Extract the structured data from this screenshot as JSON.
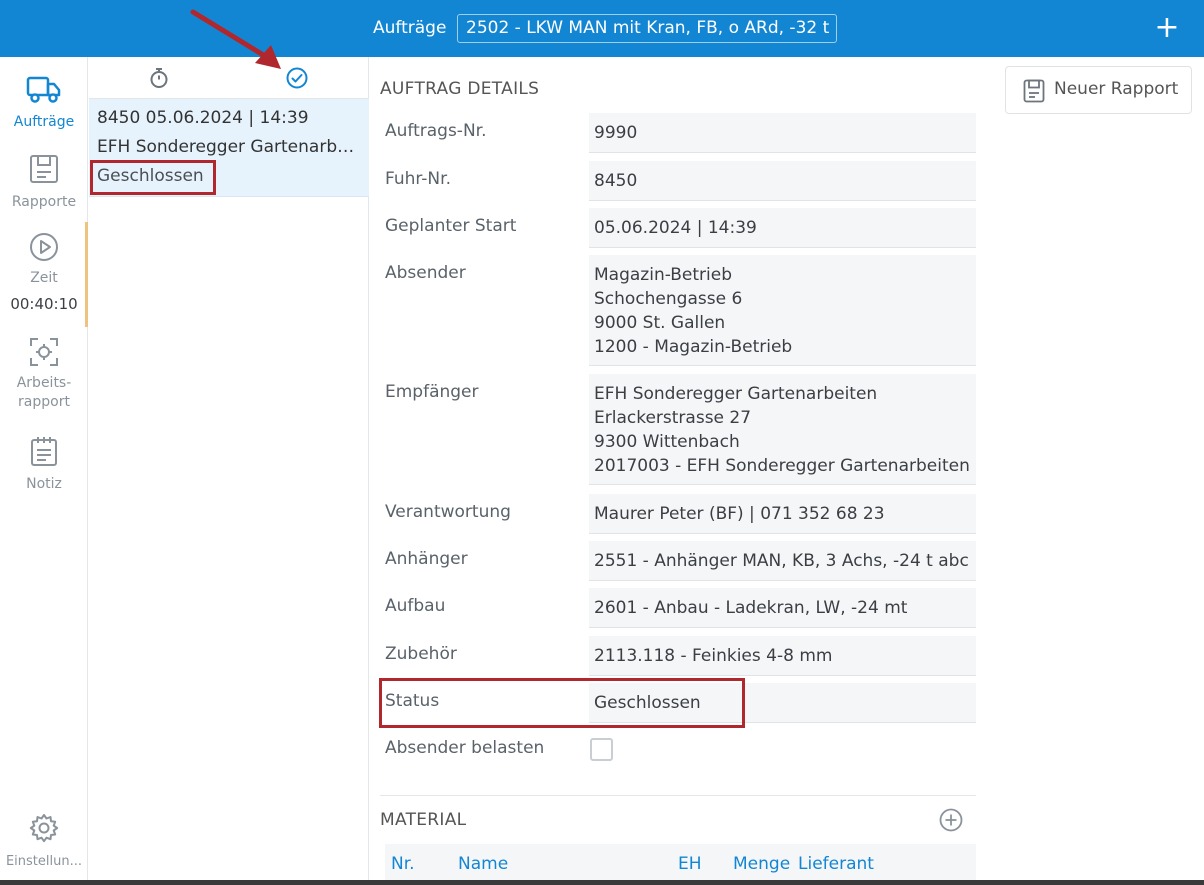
{
  "header": {
    "title": "Aufträge",
    "vehicle": "2502 - LKW MAN mit Kran, FB, o ARd, -32 t",
    "add_icon": "plus-icon"
  },
  "nav": {
    "items": [
      {
        "label": "Aufträge",
        "icon": "truck-icon"
      },
      {
        "label": "Rapporte",
        "icon": "report-icon"
      },
      {
        "label": "Zeit",
        "icon": "play-icon",
        "timer": "00:40:10"
      },
      {
        "label": "Arbeits-",
        "label2": "rapport",
        "icon": "scan-icon"
      },
      {
        "label": "Notiz",
        "icon": "notepad-icon"
      },
      {
        "label": "Einstellun...",
        "icon": "gear-icon"
      }
    ]
  },
  "list": {
    "entry": {
      "line1": "8450  05.06.2024 | 14:39",
      "line2": "EFH Sonderegger Gartenarbeiten",
      "status": "Geschlossen"
    }
  },
  "details": {
    "section_title": "AUFTRAG DETAILS",
    "rows": [
      {
        "label": "Auftrags-Nr.",
        "value": "9990"
      },
      {
        "label": "Fuhr-Nr.",
        "value": "8450"
      },
      {
        "label": "Geplanter Start",
        "value": "05.06.2024 | 14:39"
      },
      {
        "label": "Absender",
        "value": "Magazin-Betrieb\nSchochengasse 6\n9000 St. Gallen\n1200 - Magazin-Betrieb"
      },
      {
        "label": "Empfänger",
        "value": "EFH Sonderegger Gartenarbeiten\nErlackerstrasse 27\n9300 Wittenbach\n2017003 - EFH Sonderegger Gartenarbeiten"
      },
      {
        "label": "Verantwortung",
        "value": "Maurer Peter (BF) | 071 352 68 23"
      },
      {
        "label": "Anhänger",
        "value": "2551 - Anhänger MAN, KB, 3 Achs, -24 t abc"
      },
      {
        "label": "Aufbau",
        "value": "2601 - Anbau - Ladekran, LW, -24 mt"
      },
      {
        "label": "Zubehör",
        "value": "2113.118 - Feinkies 4-8 mm"
      },
      {
        "label": "Status",
        "value": "Geschlossen"
      }
    ],
    "checkbox_label": "Absender belasten",
    "material_title": "MATERIAL",
    "material_columns": [
      "Nr.",
      "Name",
      "EH",
      "Menge",
      "Lieferant"
    ]
  },
  "right": {
    "new_report_label": "Neuer Rapport"
  },
  "colors": {
    "brand": "#1386d3",
    "highlight": "#b0282e",
    "timer_bar": "#f1c27d"
  }
}
